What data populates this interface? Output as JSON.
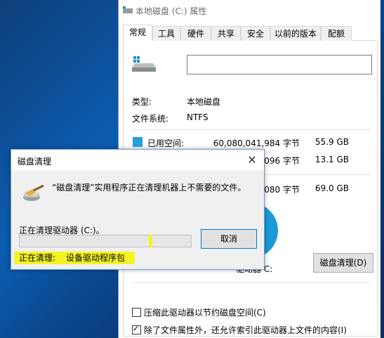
{
  "props_window": {
    "title": "本地磁盘 (C:) 属性",
    "tabs": [
      "常规",
      "工具",
      "硬件",
      "共享",
      "安全",
      "以前的版本",
      "配额"
    ],
    "active_tab": "常规",
    "name_value": "",
    "type_label": "类型:",
    "type_value": "本地磁盘",
    "fs_label": "文件系统:",
    "fs_value": "NTFS",
    "used": {
      "label": "已用空间:",
      "bytes": "60,080,041,984 字节",
      "gb": "55.9 GB",
      "color": "#26a0da"
    },
    "free": {
      "bytes": "096 字节",
      "gb": "13.1 GB"
    },
    "capacity": {
      "bytes": "080 字节",
      "gb": "69.0 GB"
    },
    "drive_label": "驱动器 C:",
    "disk_cleanup_button": "磁盘清理(D)",
    "compress_label": "压缩此驱动器以节约磁盘空间(C)",
    "compress_checked": false,
    "index_label": "除了文件属性外，还允许索引此驱动器上文件的内容(I)",
    "index_checked": true
  },
  "cleanup_dialog": {
    "title": "磁盘清理",
    "message": "“磁盘清理”实用程序正在清理机器上不需要的文件。",
    "cleaning_drive": "正在清理驱动器 (C:)。",
    "progress": 0.0,
    "cancel_button": "取消",
    "status_label": "正在清理:",
    "status_value": "设备驱动程序包"
  },
  "colors": {
    "accent": "#0078d7",
    "highlight": "#f5f500",
    "desktop": "#0b5cb0"
  }
}
